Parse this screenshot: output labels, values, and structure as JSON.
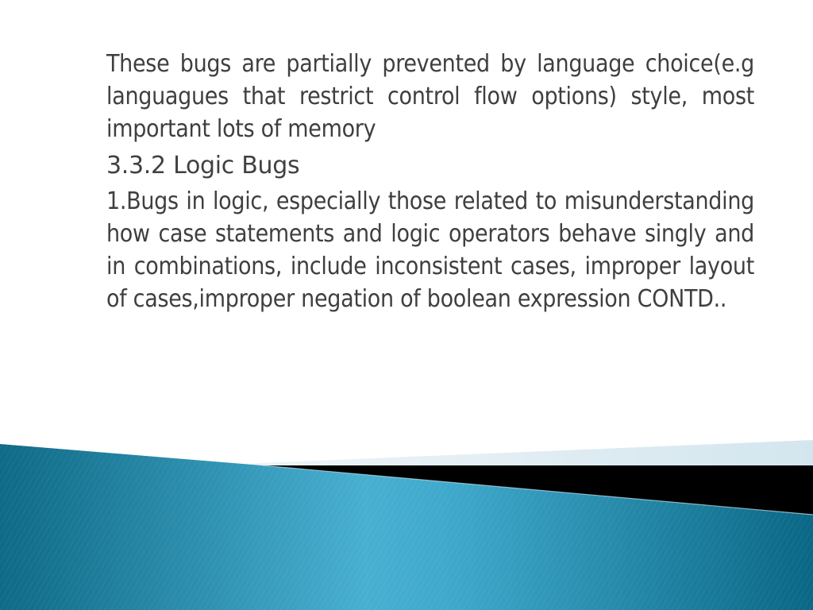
{
  "slide": {
    "intro_paragraph": "These bugs are partially prevented by language choice(e.g languagues that restrict control flow options) style, most important lots of memory",
    "section_heading": "3.3.2 Logic Bugs",
    "body_paragraph": "1.Bugs in logic, especially those related to misunderstanding how case statements and logic operators behave singly and in combinations, include inconsistent cases, improper layout of cases,improper negation of boolean expression CONTD.."
  },
  "theme": {
    "text_color": "#3f3f3f",
    "band_dark": "#0d6e8c",
    "band_light": "#4fb3d4",
    "band_accent_light": "#d7e8ef",
    "band_black": "#000000"
  }
}
